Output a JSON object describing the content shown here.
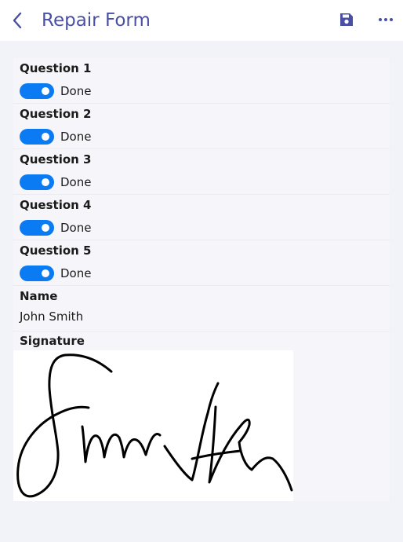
{
  "header": {
    "title": "Repair Form",
    "back_icon": "chevron-left-icon",
    "save_icon": "save-icon",
    "more_icon": "more-horizontal-icon",
    "accent_color": "#4a4fa6"
  },
  "questions": [
    {
      "label": "Question 1",
      "toggle_text": "Done",
      "on": true
    },
    {
      "label": "Question 2",
      "toggle_text": "Done",
      "on": true
    },
    {
      "label": "Question 3",
      "toggle_text": "Done",
      "on": true
    },
    {
      "label": "Question 4",
      "toggle_text": "Done",
      "on": true
    },
    {
      "label": "Question 5",
      "toggle_text": "Done",
      "on": true
    }
  ],
  "name": {
    "label": "Name",
    "value": "John Smith"
  },
  "signature": {
    "label": "Signature"
  },
  "toggle_color": "#0a7bf2"
}
